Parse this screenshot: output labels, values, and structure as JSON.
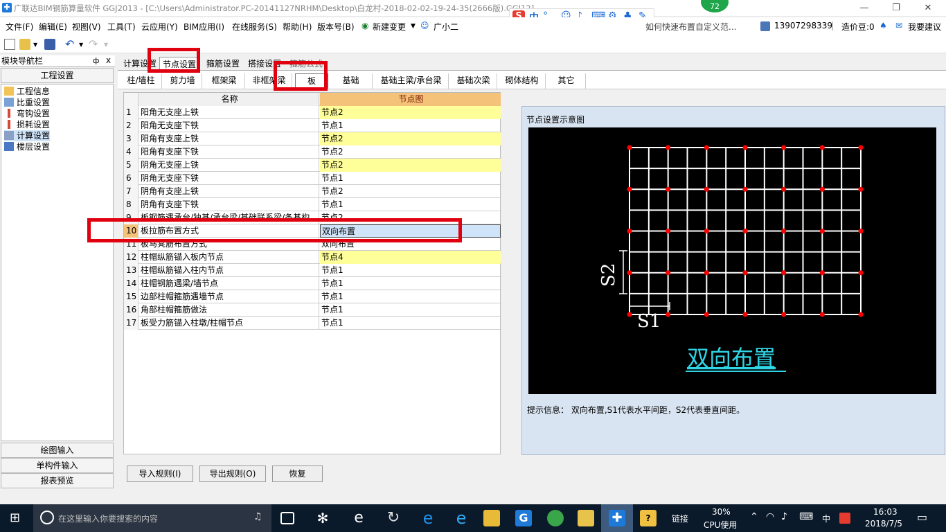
{
  "titlebar": {
    "title": "广联达BIM钢筋算量软件 GGJ2013 - [C:\\Users\\Administrator.PC-20141127NRHM\\Desktop\\白龙村-2018-02-02-19-24-35(2666版).GGJ12]",
    "badge": "72",
    "minimize": "—",
    "restore": "❐",
    "close": "✕"
  },
  "ime": {
    "logo": "S",
    "lang": "中",
    "punct": "°,"
  },
  "menus": [
    "文件(F)",
    "编辑(E)",
    "视图(V)",
    "工具(T)",
    "云应用(Y)",
    "BIM应用(I)",
    "在线服务(S)",
    "帮助(H)",
    "版本号(B)",
    "新建变更",
    "广小二"
  ],
  "help_link": "如何快速布置自定义范...",
  "user": {
    "phone": "13907298339",
    "coins": "造价豆:0",
    "suggest": "我要建议"
  },
  "nav": {
    "header": "模块导航栏",
    "pin": "ф",
    "close": "x",
    "top_section": "工程设置",
    "items": [
      "工程信息",
      "比重设置",
      "弯钩设置",
      "损耗设置",
      "计算设置",
      "楼层设置"
    ],
    "bottom_sections": [
      "绘图输入",
      "单构件输入",
      "报表预览"
    ]
  },
  "tabs1": [
    "计算设置",
    "节点设置",
    "箍筋设置",
    "搭接设置",
    "箍筋公式"
  ],
  "tabs2": [
    "柱/墙柱",
    "剪力墙",
    "框架梁",
    "非框架梁",
    "板",
    "基础",
    "基础主梁/承台梁",
    "基础次梁",
    "砌体结构",
    "其它"
  ],
  "grid": {
    "headers": [
      "名称",
      "节点图"
    ],
    "rows": [
      {
        "n": "1",
        "name": "阳角无支座上铁",
        "val": "节点2",
        "hl": true
      },
      {
        "n": "2",
        "name": "阳角无支座下铁",
        "val": "节点1",
        "hl": false
      },
      {
        "n": "3",
        "name": "阳角有支座上铁",
        "val": "节点2",
        "hl": true
      },
      {
        "n": "4",
        "name": "阳角有支座下铁",
        "val": "节点2",
        "hl": false
      },
      {
        "n": "5",
        "name": "阴角无支座上铁",
        "val": "节点2",
        "hl": true
      },
      {
        "n": "6",
        "name": "阴角无支座下铁",
        "val": "节点1",
        "hl": false
      },
      {
        "n": "7",
        "name": "阴角有支座上铁",
        "val": "节点2",
        "hl": false
      },
      {
        "n": "8",
        "name": "阴角有支座下铁",
        "val": "节点1",
        "hl": false
      },
      {
        "n": "9",
        "name": "板钢筋遇承台/独基/承台梁/基础联系梁/条基构",
        "val": "节点2",
        "hl": false
      },
      {
        "n": "10",
        "name": "板拉筋布置方式",
        "val": "双向布置",
        "hl": false,
        "sel": true
      },
      {
        "n": "11",
        "name": "板马凳筋布置方式",
        "val": "双向布置",
        "hl": false
      },
      {
        "n": "12",
        "name": "柱帽纵筋锚入板内节点",
        "val": "节点4",
        "hl": true
      },
      {
        "n": "13",
        "name": "柱帽纵筋锚入柱内节点",
        "val": "节点1",
        "hl": false
      },
      {
        "n": "14",
        "name": "柱帽钢筋遇梁/墙节点",
        "val": "节点1",
        "hl": false
      },
      {
        "n": "15",
        "name": "边部柱帽箍筋遇墙节点",
        "val": "节点1",
        "hl": false
      },
      {
        "n": "16",
        "name": "角部柱帽箍筋做法",
        "val": "节点1",
        "hl": false
      },
      {
        "n": "17",
        "name": "板受力筋锚入柱墩/柱帽节点",
        "val": "节点1",
        "hl": false
      }
    ]
  },
  "preview": {
    "title": "节点设置示意图",
    "label_s1": "S1",
    "label_s2": "S2",
    "caption": "双向布置",
    "hint": "提示信息： 双向布置,S1代表水平间距，S2代表垂直间距。"
  },
  "buttons": [
    "导入规则(I)",
    "导出规则(O)",
    "恢复"
  ],
  "taskbar": {
    "search_placeholder": "在这里输入你要搜索的内容",
    "link": "链接",
    "cpu_pct": "30%",
    "cpu_label": "CPU使用",
    "lang": "中",
    "time": "16:03",
    "date": "2018/7/5"
  },
  "colors": {
    "highlight": "#ffff99",
    "annotation": "#e0000f",
    "caption": "#2fd6e6",
    "rebar": "#ff0000"
  }
}
